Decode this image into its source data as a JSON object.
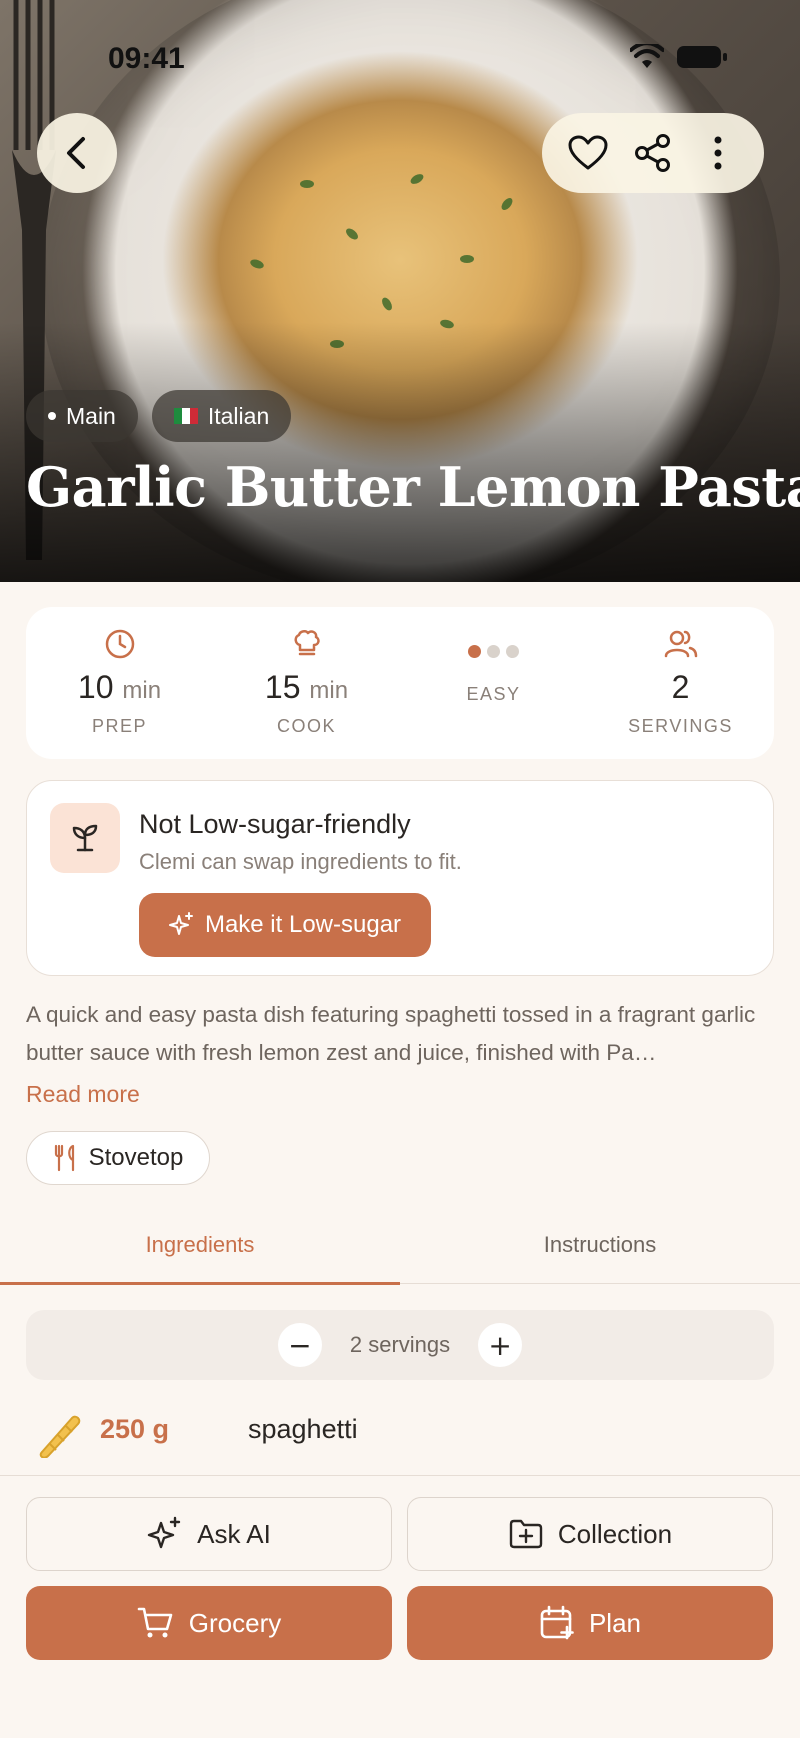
{
  "status_bar": {
    "time": "09:41"
  },
  "hero": {
    "tags": [
      "Main",
      "Italian"
    ],
    "title": "Garlic Butter Lemon Pasta"
  },
  "stats": {
    "prep": {
      "value": "10",
      "unit": "min",
      "label": "PREP"
    },
    "cook": {
      "value": "15",
      "unit": "min",
      "label": "COOK"
    },
    "difficulty": {
      "label": "EASY",
      "level": 1,
      "max": 3
    },
    "servings": {
      "value": "2",
      "label": "SERVINGS"
    }
  },
  "diet_card": {
    "title": "Not Low-sugar-friendly",
    "subtitle": "Clemi can swap ingredients to fit.",
    "button": "Make it Low-sugar"
  },
  "description": {
    "text": "A quick and easy pasta dish featuring spaghetti tossed in a fragrant garlic butter sauce with fresh lemon zest and juice, finished with Pa…",
    "read_more": "Read more"
  },
  "method_tag": "Stovetop",
  "tabs": [
    "Ingredients",
    "Instructions"
  ],
  "servings_control": {
    "label": "2 servings",
    "minus": "−",
    "plus": "+"
  },
  "ingredients": [
    {
      "amount": "250 g",
      "name": "spaghetti",
      "icon": "pasta-icon"
    }
  ],
  "bottom_actions": {
    "ask_ai": "Ask AI",
    "collection": "Collection",
    "grocery": "Grocery",
    "plan": "Plan"
  },
  "colors": {
    "accent": "#C8704A",
    "background": "#FBF6F1",
    "accent_light": "#FBE3D6"
  }
}
